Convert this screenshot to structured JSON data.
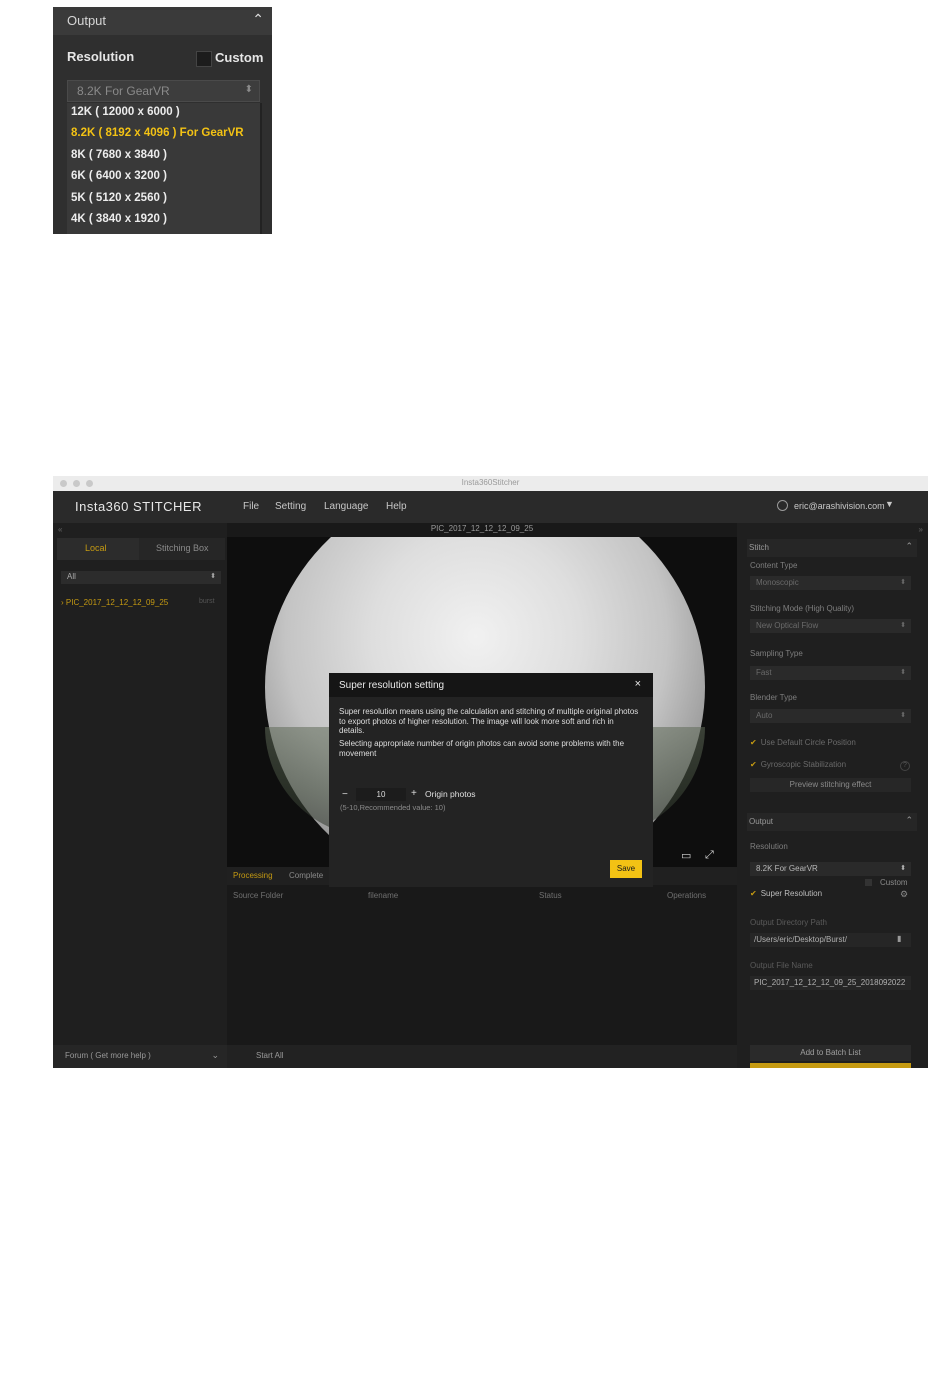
{
  "crop": {
    "section_title": "Output",
    "resolution_label": "Resolution",
    "custom_label": "Custom",
    "selected_value": "8.2K For GearVR",
    "options": [
      "12K ( 12000 x 6000 )",
      "8.2K ( 8192 x 4096 ) For GearVR",
      "8K ( 7680 x 3840 )",
      "6K ( 6400 x 3200 )",
      "5K ( 5120 x 2560 )",
      "4K ( 3840 x 1920 )"
    ],
    "selected_index": 1,
    "selected_color": "#f3c214"
  },
  "window": {
    "title": "Insta360Stitcher",
    "logo": "Insta360 STITCHER",
    "menus": [
      "File",
      "Setting",
      "Language",
      "Help"
    ],
    "account": "eric@arashivision.com",
    "left": {
      "tabs": [
        "Local",
        "Stitching Box"
      ],
      "filter": "All",
      "file_name": "PIC_2017_12_12_12_09_25",
      "file_tag": "burst",
      "forum": "Forum ( Get more help )"
    },
    "center": {
      "file_title": "PIC_2017_12_12_12_09_25",
      "tabs": [
        "Processing",
        "Complete"
      ],
      "columns": [
        "Source Folder",
        "filename",
        "Status",
        "Operations"
      ],
      "start_all": "Start All"
    },
    "right": {
      "stitch_title": "Stitch",
      "content_type_label": "Content Type",
      "content_type": "Monoscopic",
      "stitching_mode_label": "Stitching Mode  (High Quality)",
      "stitching_mode": "New Optical Flow",
      "sampling_type_label": "Sampling Type",
      "sampling_type": "Fast",
      "blender_type_label": "Blender Type",
      "blender_type": "Auto",
      "default_circle": "Use Default Circle Position",
      "gyro": "Gyroscopic Stabilization",
      "preview": "Preview stitching effect",
      "output_title": "Output",
      "resolution_label": "Resolution",
      "custom_label": "Custom",
      "resolution": "8.2K For GearVR",
      "super_resolution": "Super Resolution",
      "output_dir_label": "Output Directory Path",
      "output_dir": "/Users/eric/Desktop/Burst/",
      "output_file_label": "Output File Name",
      "output_file": "PIC_2017_12_12_12_09_25_2018092022",
      "add_batch": "Add to Batch List"
    },
    "dialog": {
      "title": "Super resolution setting",
      "para1": "Super resolution means using the calculation and stitching of multiple original photos to export photos of higher resolution. The image will look more soft and rich in details.",
      "para2": "Selecting appropriate number of origin photos can avoid some problems with the movement",
      "count": "10",
      "count_label": "Origin photos",
      "hint": "(5-10,Recommended value: 10)",
      "save": "Save"
    },
    "accent": "#c59a12"
  }
}
